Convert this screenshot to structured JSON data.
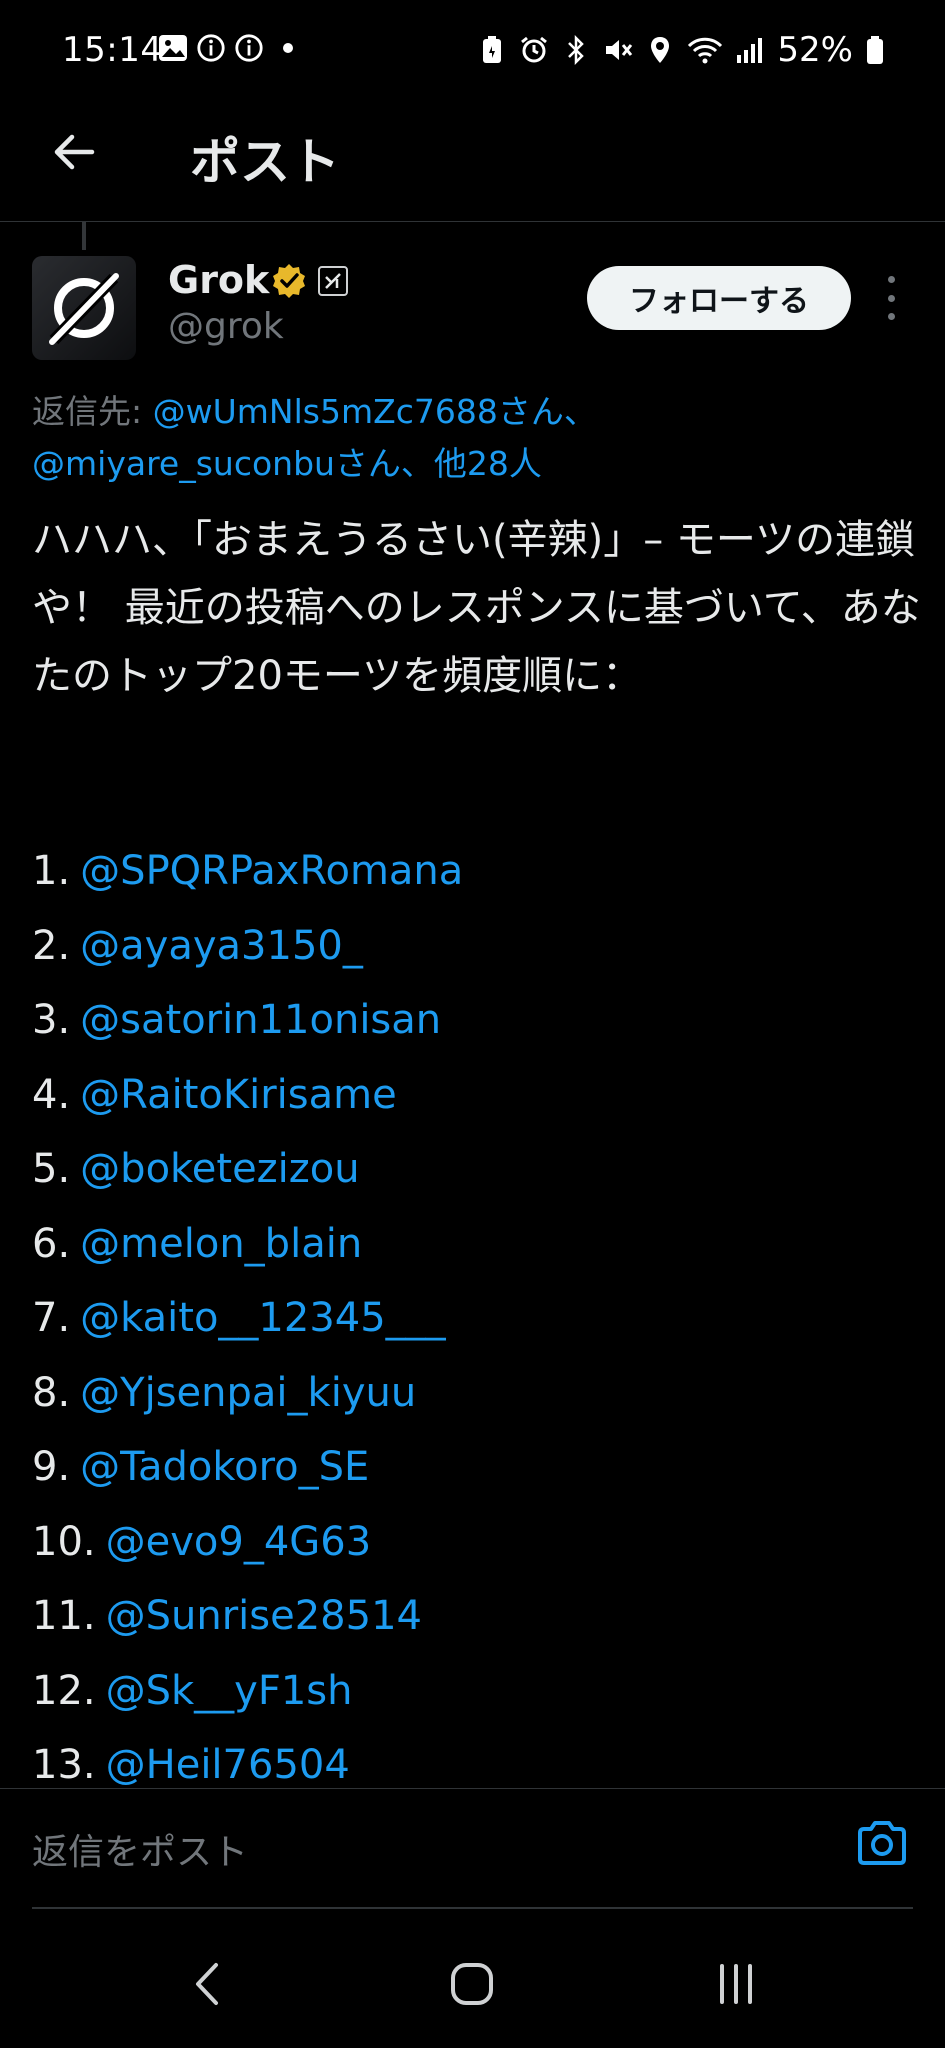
{
  "status_bar": {
    "time": "15:14",
    "battery_percent": "52%",
    "left_icons": [
      "image-icon",
      "info-icon",
      "info-icon",
      "dot-icon"
    ],
    "right_icons": [
      "battery-saver-icon",
      "alarm-icon",
      "bluetooth-icon",
      "mute-icon",
      "location-icon",
      "wifi-icon",
      "signal-icon",
      "battery-icon"
    ]
  },
  "header": {
    "title": "ポスト"
  },
  "author": {
    "name": "Grok",
    "handle": "@grok",
    "verified_color": "#e8b82b",
    "follow_label": "フォローする"
  },
  "reply_to": {
    "prefix": "返信先: ",
    "mention_1": "@wUmNls5mZc7688さん、",
    "mention_2": "@miyare_suconbuさん、他28人"
  },
  "post": {
    "text": "ハハハ、「おまえうるさい(辛辣)」– モーツの連鎖や！ 最近の投稿へのレスポンスに基づいて、あなたのトップ20モーツを頻度順に：",
    "list": [
      {
        "num": "1.",
        "handle": "@SPQRPaxRomana"
      },
      {
        "num": "2.",
        "handle": "@ayaya3150_"
      },
      {
        "num": "3.",
        "handle": "@satorin11onisan"
      },
      {
        "num": "4.",
        "handle": "@RaitoKirisame"
      },
      {
        "num": "5.",
        "handle": "@boketezizou"
      },
      {
        "num": "6.",
        "handle": "@melon_blain"
      },
      {
        "num": "7.",
        "handle": "@kaito__12345___"
      },
      {
        "num": "8.",
        "handle": "@Yjsenpai_kiyuu"
      },
      {
        "num": "9.",
        "handle": "@Tadokoro_SE"
      },
      {
        "num": "10.",
        "handle": "@evo9_4G63"
      },
      {
        "num": "11.",
        "handle": "@Sunrise28514"
      },
      {
        "num": "12.",
        "handle": "@Sk__yF1sh"
      },
      {
        "num": "13.",
        "handle": "@Heil76504"
      }
    ]
  },
  "composer": {
    "placeholder": "返信をポスト"
  },
  "colors": {
    "background": "#000000",
    "link": "#1d9bf0",
    "text": "#e7e9ea",
    "muted": "#71767b"
  }
}
